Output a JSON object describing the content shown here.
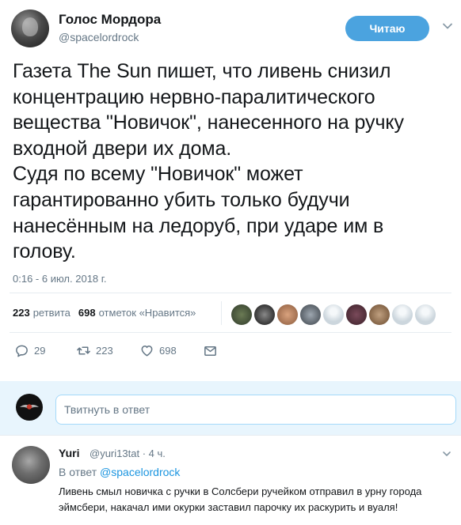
{
  "header": {
    "name": "Голос Мордора",
    "handle": "@spacelordrock",
    "follow_label": "Читаю",
    "accent": "#4ba3df"
  },
  "tweet": {
    "text": "Газета The Sun пишет, что ливень снизил\nконцентрацию нервно-паралитического\nвещества \"Новичок\", нанесенного на ручку\nвходной двери их дома.\nСудя по всему \"Новичок\" может\nгарантированно убить только будучи\nнанесённым на ледоруб, при ударе им в\nголову.",
    "timestamp": "0:16 - 6 июл. 2018 г."
  },
  "stats": {
    "retweets_count": "223",
    "retweets_label": "ретвита",
    "likes_count": "698",
    "likes_label": "отметок «Нравится»",
    "liker_avatars": 10
  },
  "actions": {
    "reply_icon": "reply-icon",
    "reply_count": "29",
    "retweet_icon": "retweet-icon",
    "retweet_count": "223",
    "like_icon": "heart-icon",
    "like_count": "698",
    "dm_icon": "envelope-icon"
  },
  "reply_box": {
    "placeholder": "Твитнуть в ответ",
    "background": "#e8f5fd"
  },
  "reply": {
    "name": "Yuri",
    "handle": "@yuri13tat",
    "time": "4 ч.",
    "in_reply_prefix": "В ответ",
    "in_reply_handle": "@spacelordrock",
    "text": "Ливень смыл новичка с ручки в Солсбери ручейком отправил в урну города эймсбери, накачал ими окурки заставил парочку их раскурить и вуаля!",
    "link_color": "#1b95e0"
  }
}
